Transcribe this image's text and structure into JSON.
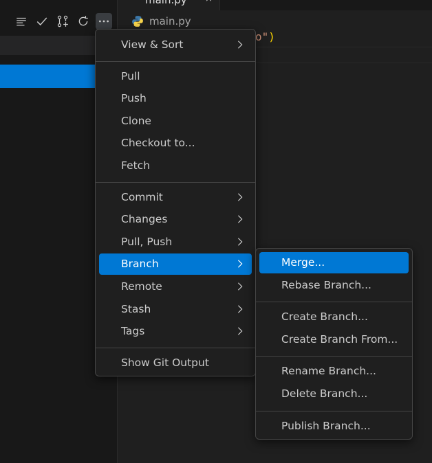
{
  "editor": {
    "tab_title": "main.py",
    "tab_close": "×",
    "breadcrumb_file": "main.py",
    "code_fragment_str": "o\"",
    "code_fragment_paren": ")"
  },
  "sidebar": {
    "toolbar_icons": [
      "view-list-icon",
      "check-icon",
      "git-pull-request-create-icon",
      "refresh-icon",
      "more-actions-icon"
    ]
  },
  "menu": {
    "groups": [
      [
        {
          "label": "View & Sort",
          "submenu": true
        }
      ],
      [
        {
          "label": "Pull"
        },
        {
          "label": "Push"
        },
        {
          "label": "Clone"
        },
        {
          "label": "Checkout to..."
        },
        {
          "label": "Fetch"
        }
      ],
      [
        {
          "label": "Commit",
          "submenu": true
        },
        {
          "label": "Changes",
          "submenu": true
        },
        {
          "label": "Pull, Push",
          "submenu": true
        },
        {
          "label": "Branch",
          "submenu": true,
          "highlighted": true
        },
        {
          "label": "Remote",
          "submenu": true
        },
        {
          "label": "Stash",
          "submenu": true
        },
        {
          "label": "Tags",
          "submenu": true
        }
      ],
      [
        {
          "label": "Show Git Output"
        }
      ]
    ]
  },
  "submenu": {
    "groups": [
      [
        {
          "label": "Merge...",
          "highlighted": true
        },
        {
          "label": "Rebase Branch..."
        }
      ],
      [
        {
          "label": "Create Branch..."
        },
        {
          "label": "Create Branch From..."
        }
      ],
      [
        {
          "label": "Rename Branch..."
        },
        {
          "label": "Delete Branch..."
        }
      ],
      [
        {
          "label": "Publish Branch..."
        }
      ]
    ]
  },
  "colors": {
    "accent": "#0078d4",
    "menu_bg": "#1f1f1f",
    "menu_border": "#454545"
  }
}
